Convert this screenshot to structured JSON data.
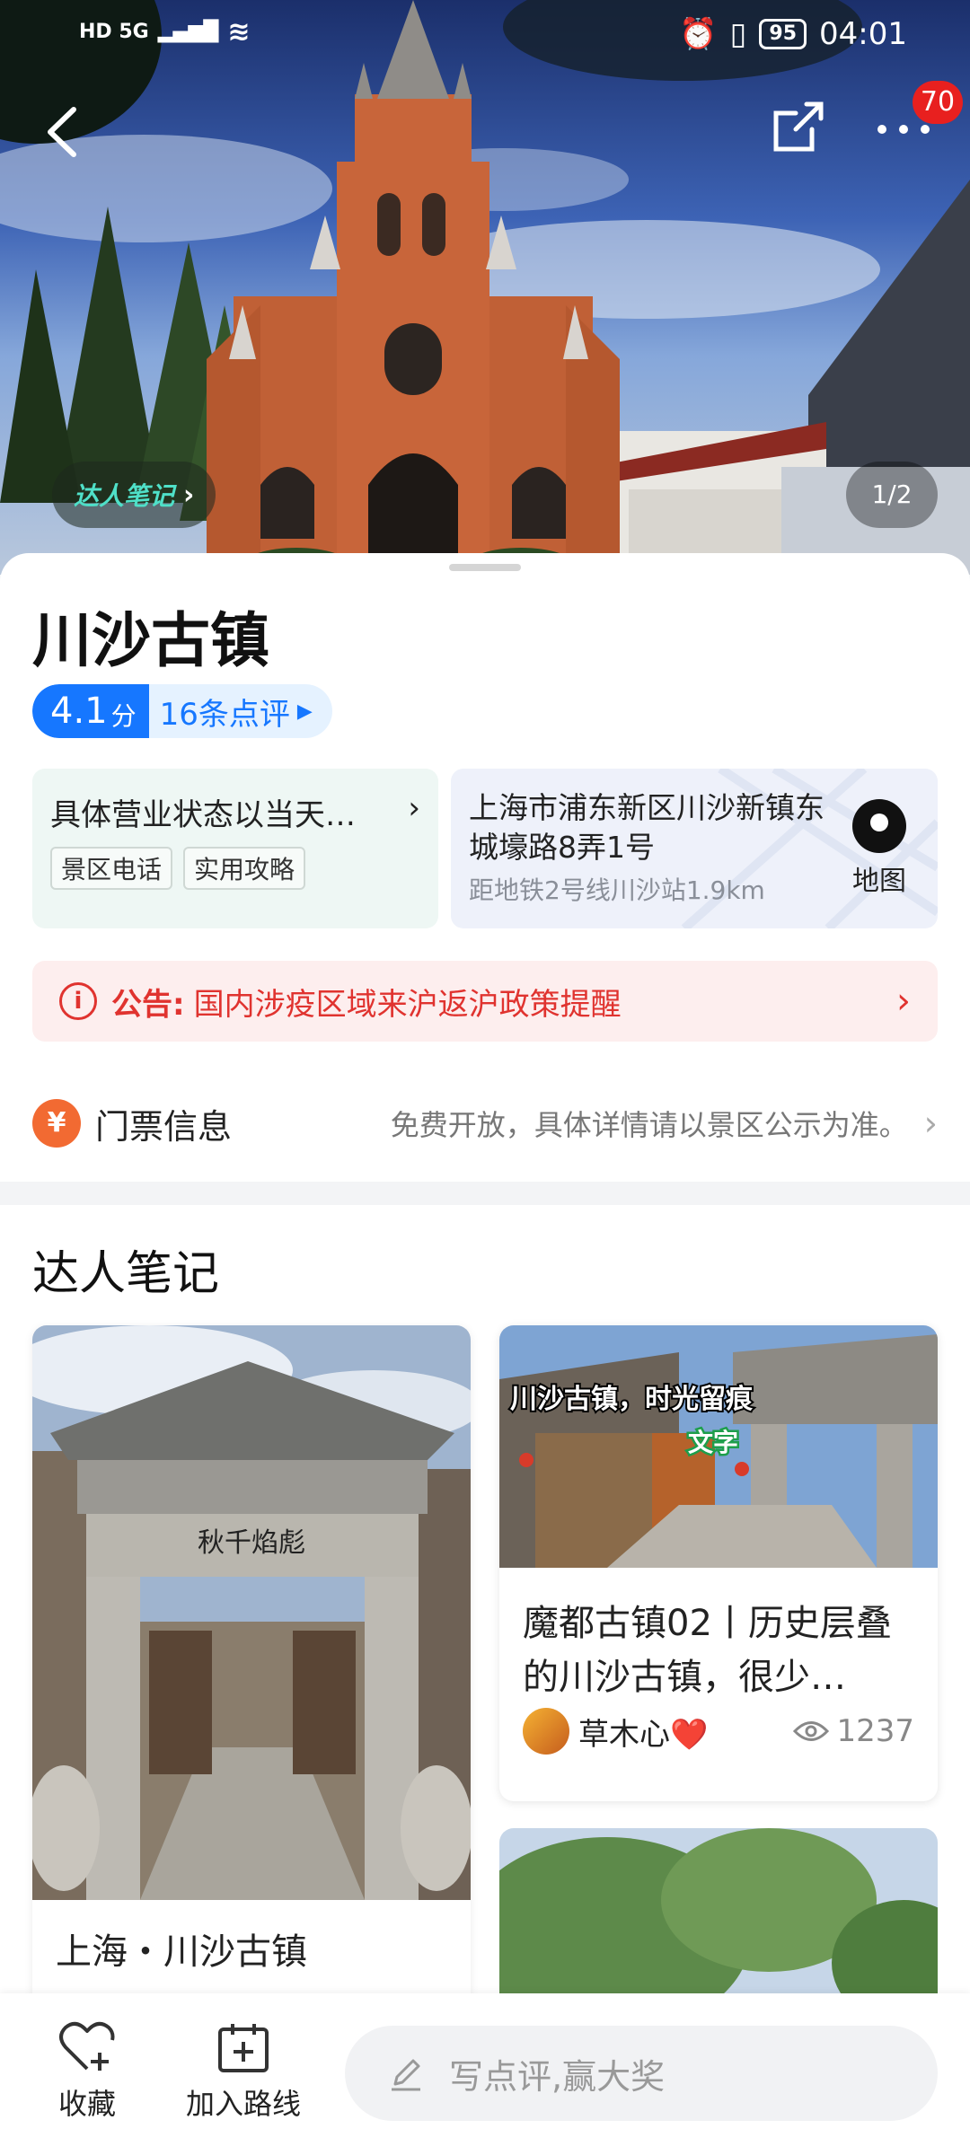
{
  "status_bar": {
    "network": "HD 5G",
    "battery": "95",
    "time": "04:01"
  },
  "top_bar": {
    "menu_badge": "70"
  },
  "hero": {
    "notes_pill": "达人笔记",
    "pager": "1/2"
  },
  "place": {
    "title": "川沙古镇",
    "score": "4.1",
    "score_unit": "分",
    "reviews": "16条点评"
  },
  "hours_card": {
    "text": "具体营业状态以当天…",
    "chips": [
      "景区电话",
      "实用攻略"
    ]
  },
  "address_card": {
    "address": "上海市浦东新区川沙新镇东城壕路8弄1号",
    "distance": "距地铁2号线川沙站1.9km",
    "map_label": "地图"
  },
  "notice": {
    "label": "公告:",
    "text": "国内涉疫区域来沪返沪政策提醒"
  },
  "ticket": {
    "title": "门票信息",
    "desc": "免费开放，具体详情请以景区公示为准。"
  },
  "notes": {
    "section_title": "达人笔记",
    "left_card": {
      "caption": "上海・川沙古镇",
      "arch_text": "秋千焰彪"
    },
    "right_card": {
      "overlay_title": "川沙古镇，时光留痕",
      "overlay_tag": "文字",
      "caption": "魔都古镇02丨历史层叠的川沙古镇，很少…",
      "author": "草木心❤️",
      "views": "1237"
    }
  },
  "bottom_bar": {
    "favorite": "收藏",
    "add_route": "加入路线",
    "review_placeholder": "写点评,赢大奖"
  }
}
